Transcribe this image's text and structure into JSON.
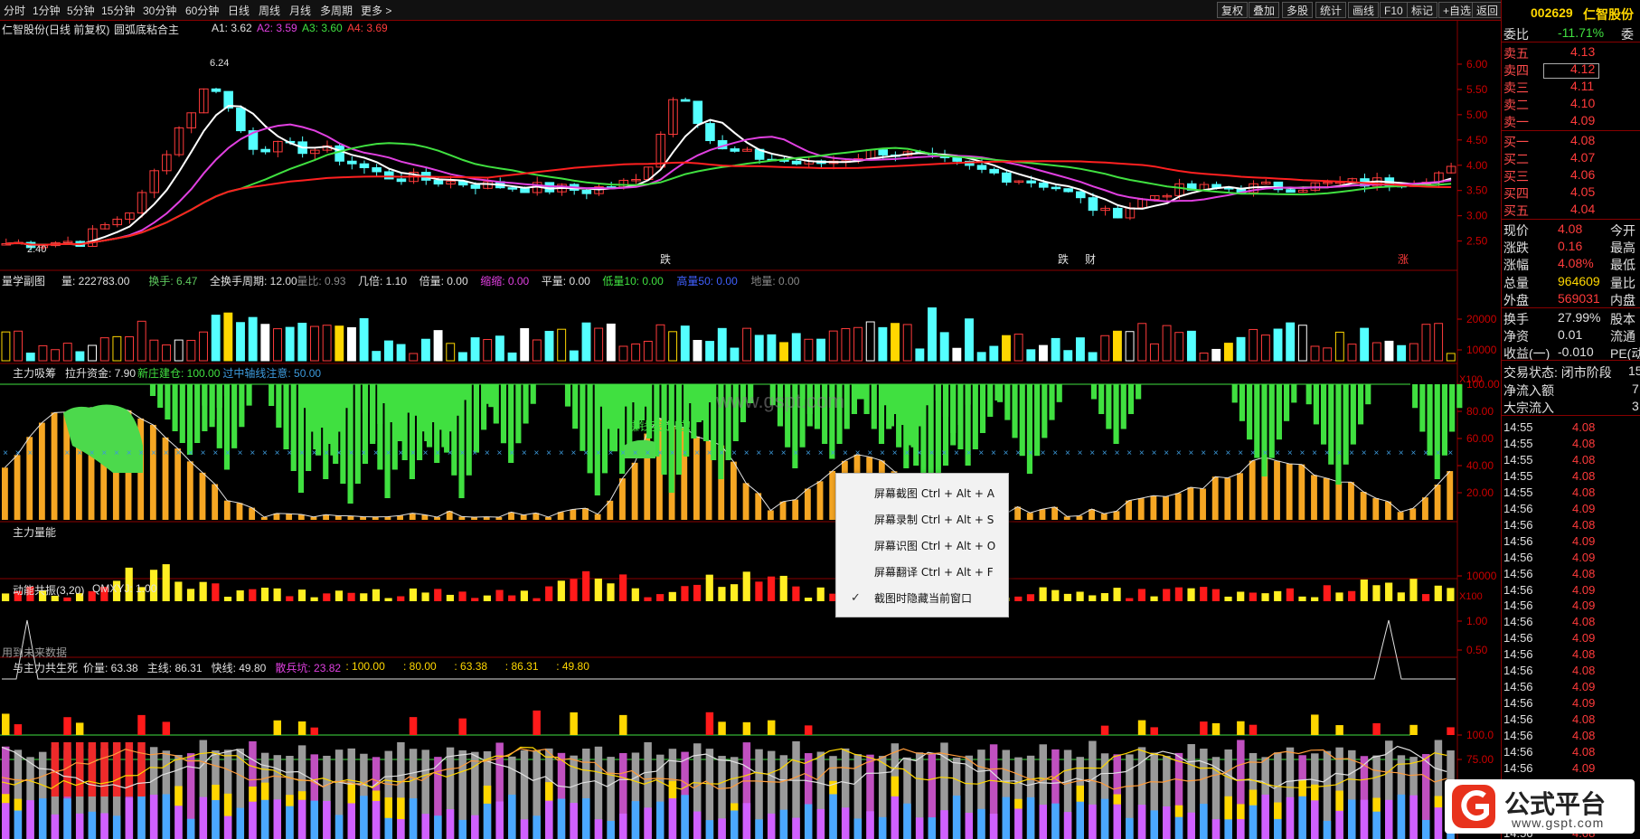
{
  "toolbar": {
    "periods": [
      "分时",
      "1分钟",
      "5分钟",
      "15分钟",
      "30分钟",
      "60分钟",
      "日线",
      "周线",
      "月线",
      "多周期",
      "更多 >"
    ],
    "right_buttons": [
      "复权",
      "叠加",
      "多股",
      "统计",
      "画线",
      "F10",
      "标记",
      "+自选",
      "返回"
    ]
  },
  "main_panel": {
    "title": "仁智股份(日线 前复权)",
    "indicator": "圆弧底粘合主",
    "a1": "A1: 3.62",
    "a2": "A2: 3.59",
    "a3": "A3: 3.60",
    "a4": "A4: 3.69",
    "high_label": "6.24",
    "low_label": "2.40",
    "y_ticks": [
      "6.00",
      "5.50",
      "5.00",
      "4.50",
      "4.00",
      "3.50",
      "3.00",
      "2.50"
    ],
    "markers": [
      "跌",
      "跌",
      "财",
      "涨"
    ]
  },
  "volume_panel": {
    "title": "量学副图",
    "stats": [
      {
        "t": "量: 222783.00",
        "c": "#e0e0e0"
      },
      {
        "t": "换手: 6.47",
        "c": "#5ec95e"
      },
      {
        "t": "全换手周期: 12.00",
        "c": "#e0e0e0"
      },
      {
        "t": "量比: 0.93",
        "c": "#888"
      },
      {
        "t": "几倍: 1.10",
        "c": "#e0e0e0"
      },
      {
        "t": "倍量: 0.00",
        "c": "#e0e0e0"
      },
      {
        "t": "缩缩: 0.00",
        "c": "#e040e0"
      },
      {
        "t": "平量: 0.00",
        "c": "#e0e0e0"
      },
      {
        "t": "低量10: 0.00",
        "c": "#40e040"
      },
      {
        "t": "高量50: 0.00",
        "c": "#4060ff"
      },
      {
        "t": "地量: 0.00",
        "c": "#888"
      }
    ],
    "y_ticks": [
      "20000",
      "10000"
    ],
    "unit": "X100"
  },
  "accum_panel": {
    "title": "主力吸筹",
    "stats": [
      {
        "t": "拉升资金: 7.90",
        "c": "#e0e0e0"
      },
      {
        "t": "新庄建仓: 100.00",
        "c": "#40e040"
      },
      {
        "t": "过中轴线注意: 50.00",
        "c": "#3c9adc"
      }
    ],
    "annotation": "赚钱我走啦！",
    "watermark": "www.gspt.com",
    "y_ticks": [
      "100.00",
      "80.00",
      "60.00",
      "40.00",
      "20.00"
    ]
  },
  "mainvol_panel": {
    "title": "主力量能",
    "y_ticks": [
      "10000"
    ],
    "unit": "X100"
  },
  "resonance_panel": {
    "title": "动能共振(3,20)",
    "stat": "QMXYJ: 1.00",
    "y_ticks": [
      "1.00",
      "0.50"
    ],
    "note": "用到未来数据"
  },
  "life_panel": {
    "title": "与主力共生死",
    "stats": [
      {
        "t": "价量: 63.38",
        "c": "#e0e0e0"
      },
      {
        "t": "主线: 86.31",
        "c": "#e0e0e0"
      },
      {
        "t": "快线: 49.80",
        "c": "#e0e0e0"
      },
      {
        "t": "散兵坑: 23.82",
        "c": "#e040e0"
      },
      {
        "t": ": 100.00",
        "c": "#ffd700"
      },
      {
        "t": ": 80.00",
        "c": "#ffd700"
      },
      {
        "t": ": 63.38",
        "c": "#ffd700"
      },
      {
        "t": ": 86.31",
        "c": "#ffd700"
      },
      {
        "t": ": 49.80",
        "c": "#ffd700"
      }
    ],
    "y_ticks": [
      "100.0",
      "75.00",
      "50.00"
    ]
  },
  "context_menu": {
    "items": [
      "屏幕截图 Ctrl + Alt + A",
      "屏幕录制 Ctrl + Alt + S",
      "屏幕识图 Ctrl + Alt + O",
      "屏幕翻译 Ctrl + Alt + F"
    ],
    "checked_item": "截图时隐藏当前窗口"
  },
  "quote": {
    "code": "002629",
    "name": "仁智股份",
    "weibi_label": "委比",
    "weibi_value": "-11.71%",
    "weicha_label": "委",
    "sells": [
      {
        "label": "卖五",
        "price": "4.13"
      },
      {
        "label": "卖四",
        "price": "4.12"
      },
      {
        "label": "卖三",
        "price": "4.11"
      },
      {
        "label": "卖二",
        "price": "4.10"
      },
      {
        "label": "卖一",
        "price": "4.09"
      }
    ],
    "buys": [
      {
        "label": "买一",
        "price": "4.08"
      },
      {
        "label": "买二",
        "price": "4.07"
      },
      {
        "label": "买三",
        "price": "4.06"
      },
      {
        "label": "买四",
        "price": "4.05"
      },
      {
        "label": "买五",
        "price": "4.04"
      }
    ],
    "info": [
      {
        "l": "现价",
        "v": "4.08",
        "vc": "#ff3b3b",
        "r": "今开"
      },
      {
        "l": "涨跌",
        "v": "0.16",
        "vc": "#ff3b3b",
        "r": "最高"
      },
      {
        "l": "涨幅",
        "v": "4.08%",
        "vc": "#ff3b3b",
        "r": "最低"
      },
      {
        "l": "总量",
        "v": "964609",
        "vc": "#ffd700",
        "r": "量比"
      },
      {
        "l": "外盘",
        "v": "569031",
        "vc": "#ff3b3b",
        "r": "内盘"
      },
      {
        "l": "换手",
        "v": "27.99%",
        "vc": "#e0e0e0",
        "r": "股本"
      },
      {
        "l": "净资",
        "v": "0.01",
        "vc": "#e0e0e0",
        "r": "流通"
      },
      {
        "l": "收益(一)",
        "v": "-0.010",
        "vc": "#e0e0e0",
        "r": "PE(动"
      }
    ],
    "trade_state": "交易状态: 闭市阶段",
    "trade_state_extra": "15",
    "net_inflow_label": "净流入额",
    "net_inflow_value": "7",
    "block_inflow_label": "大宗流入",
    "block_inflow_value": "3",
    "ticks": [
      [
        "14:55",
        "4.08"
      ],
      [
        "14:55",
        "4.08"
      ],
      [
        "14:55",
        "4.08"
      ],
      [
        "14:55",
        "4.08"
      ],
      [
        "14:55",
        "4.08"
      ],
      [
        "14:56",
        "4.09"
      ],
      [
        "14:56",
        "4.08"
      ],
      [
        "14:56",
        "4.09"
      ],
      [
        "14:56",
        "4.09"
      ],
      [
        "14:56",
        "4.08"
      ],
      [
        "14:56",
        "4.09"
      ],
      [
        "14:56",
        "4.09"
      ],
      [
        "14:56",
        "4.08"
      ],
      [
        "14:56",
        "4.09"
      ],
      [
        "14:56",
        "4.08"
      ],
      [
        "14:56",
        "4.08"
      ],
      [
        "14:56",
        "4.09"
      ],
      [
        "14:56",
        "4.09"
      ],
      [
        "14:56",
        "4.08"
      ],
      [
        "14:56",
        "4.08"
      ],
      [
        "14:56",
        "4.08"
      ],
      [
        "14:56",
        "4.09"
      ],
      [
        "14:56",
        "4.08"
      ],
      [
        "14:56",
        "4.09"
      ],
      [
        "14:56",
        "4.08"
      ],
      [
        "14:56",
        "4.08"
      ],
      [
        "14:56",
        "4.08"
      ],
      [
        "14:56",
        "4.08"
      ]
    ]
  },
  "logo": {
    "text": "公式平台",
    "url": "www.gspt.com"
  },
  "colors": {
    "up": "#ff3b3b",
    "down": "#54ffff",
    "ma5": "#ffffff",
    "ma10": "#e040e0",
    "ma20": "#40e040",
    "ma60": "#ff2020",
    "accent": "#ffd700"
  }
}
